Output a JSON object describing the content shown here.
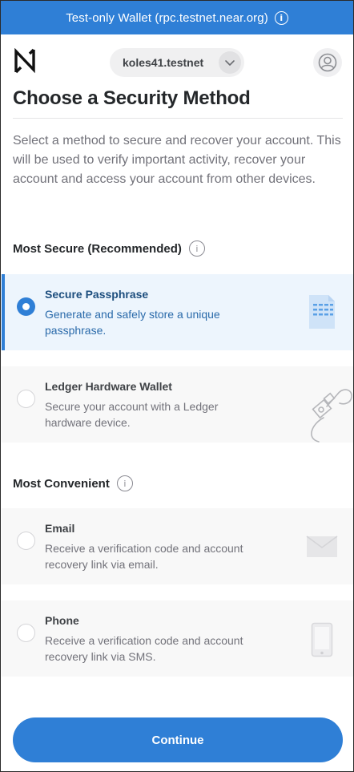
{
  "banner": {
    "text": "Test-only Wallet (rpc.testnet.near.org)",
    "icon": "info-icon"
  },
  "header": {
    "account": "koles41.testnet",
    "logo": "near-logo-icon",
    "profile_icon": "user-profile-icon"
  },
  "page": {
    "title": "Choose a Security Method",
    "description": "Select a method to secure and recover your account. This will be used to verify important activity, recover your account and access your account from other devices."
  },
  "sections": [
    {
      "title": "Most Secure (Recommended)",
      "options": [
        {
          "title": "Secure Passphrase",
          "description": "Generate and safely store a unique passphrase.",
          "selected": true,
          "icon": "passphrase-document-icon"
        },
        {
          "title": "Ledger Hardware Wallet",
          "description": "Secure your account with a Ledger hardware device.",
          "selected": false,
          "icon": "ledger-device-icon"
        }
      ]
    },
    {
      "title": "Most Convenient",
      "options": [
        {
          "title": "Email",
          "description": "Receive a verification code and account recovery link via email.",
          "selected": false,
          "icon": "envelope-icon"
        },
        {
          "title": "Phone",
          "description": "Receive a verification code and account recovery link via SMS.",
          "selected": false,
          "icon": "phone-icon"
        }
      ]
    }
  ],
  "actions": {
    "continue_label": "Continue"
  },
  "colors": {
    "accent": "#2f7fd6",
    "selected_bg": "#edf5fd",
    "option_bg": "#f8f8f8",
    "title": "#24272a",
    "muted": "#72727a"
  }
}
